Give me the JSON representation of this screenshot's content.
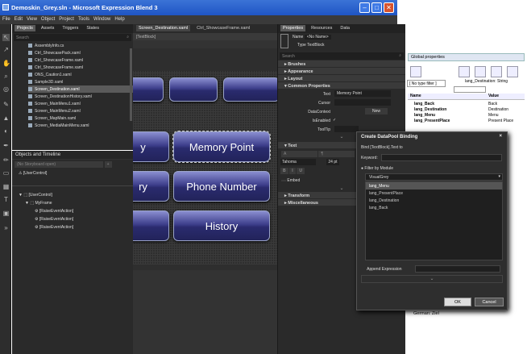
{
  "window": {
    "title": "Demoskin_Grey.sln - Microsoft Expression Blend 3"
  },
  "menu": [
    "File",
    "Edit",
    "View",
    "Object",
    "Project",
    "Tools",
    "Window",
    "Help"
  ],
  "project_panel": {
    "tabs": [
      "Projects",
      "Assets",
      "Triggers",
      "States"
    ],
    "search_placeholder": "Search",
    "files": [
      "AssemblyInfo.cs",
      "Ctrl_ShowcasePack.xaml",
      "Ctrl_ShowcaseFrame.xaml",
      "Ctrl_ShowcaseFrame.xaml",
      "ONS_Caution1.xaml",
      "Sample3D.xaml",
      "Screen_Destination.xaml",
      "Screen_DestinationHistory.xaml",
      "Screen_MainMenu1.xaml",
      "Screen_MainMenu2.xaml",
      "Screen_MapMain.xaml",
      "Screen_MediaMainMenu.xaml"
    ],
    "selected_index": 6
  },
  "objects_panel": {
    "title": "Objects and Timeline",
    "storyboard": "(No Storyboard open)",
    "root": "[UserControl]",
    "tree": [
      "[UserControl]",
      "MyFrame",
      "[RaiseEventAction]",
      "[RaiseEventAction]",
      "[RaiseEventAction]"
    ]
  },
  "document": {
    "tabs": [
      "Screen_Destination.xaml",
      "Ctrl_ShowcaseFrame.xaml"
    ],
    "breadcrumb": "[TextBlock]",
    "buttons": [
      "y",
      "Memory Point",
      "ry",
      "Phone Number",
      "History"
    ]
  },
  "properties_panel": {
    "tabs": [
      "Properties",
      "Resources",
      "Data"
    ],
    "name_label": "Name",
    "name_value": "<No Name>",
    "type_label": "Type",
    "type_value": "TextBlock",
    "search_placeholder": "Search",
    "sections": [
      "Brushes",
      "Appearance",
      "Layout",
      "Common Properties"
    ],
    "rows": [
      {
        "label": "Text",
        "value": "Memory Point"
      },
      {
        "label": "Cursor",
        "value": ""
      },
      {
        "label": "DataContext",
        "value": "New"
      },
      {
        "label": "IsEnabled",
        "value": "✓"
      },
      {
        "label": "ToolTip",
        "value": ""
      }
    ],
    "text_section": "Text",
    "font": "Tahoma",
    "font_size": "24 pt",
    "format_buttons": [
      "B",
      "I",
      "U"
    ],
    "embed_label": "Embed",
    "more_sections": [
      "Transform",
      "Miscellaneous"
    ]
  },
  "global_panel": {
    "title": "Global properties",
    "filter": "[ No type filter ]",
    "selected_header": "lang_Destination: String",
    "headers": [
      "Name",
      "Value"
    ],
    "rows": [
      {
        "name": "lang_Back",
        "value": "Back"
      },
      {
        "name": "lang_Destination",
        "value": "Destination"
      },
      {
        "name": "lang_Menu",
        "value": "Menu"
      },
      {
        "name": "lang_PresentPlace",
        "value": "Present Place"
      }
    ],
    "footer": "German: Ziel"
  },
  "dialog": {
    "title": "Create DataPool Binding",
    "subtitle": "Bind [TextBlock].Text to",
    "keyword_label": "Keyword:",
    "filter_label": "Filter by Module",
    "module": "VisualGrey",
    "items": [
      "lang_Menu",
      "lang_PresentPlace",
      "lang_Destination",
      "lang_Back"
    ],
    "selected_item": 0,
    "append_label": "Append Expression",
    "ok": "OK",
    "cancel": "Cancel"
  },
  "colors": {
    "titlebar": "#1f55c4",
    "dark_bg": "#2a2a2a",
    "button_blue": "#3e3f8c"
  }
}
